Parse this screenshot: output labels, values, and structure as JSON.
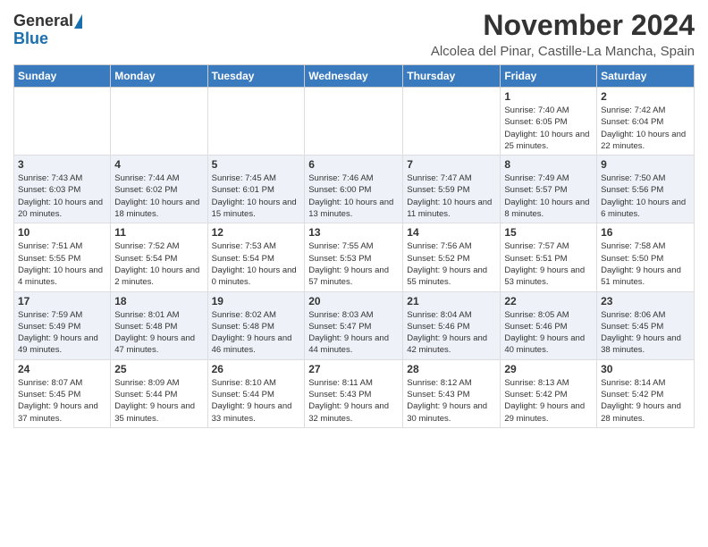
{
  "header": {
    "logo_general": "General",
    "logo_blue": "Blue",
    "month": "November 2024",
    "location": "Alcolea del Pinar, Castille-La Mancha, Spain"
  },
  "columns": [
    "Sunday",
    "Monday",
    "Tuesday",
    "Wednesday",
    "Thursday",
    "Friday",
    "Saturday"
  ],
  "weeks": [
    [
      {
        "day": "",
        "info": ""
      },
      {
        "day": "",
        "info": ""
      },
      {
        "day": "",
        "info": ""
      },
      {
        "day": "",
        "info": ""
      },
      {
        "day": "",
        "info": ""
      },
      {
        "day": "1",
        "info": "Sunrise: 7:40 AM\nSunset: 6:05 PM\nDaylight: 10 hours and 25 minutes."
      },
      {
        "day": "2",
        "info": "Sunrise: 7:42 AM\nSunset: 6:04 PM\nDaylight: 10 hours and 22 minutes."
      }
    ],
    [
      {
        "day": "3",
        "info": "Sunrise: 7:43 AM\nSunset: 6:03 PM\nDaylight: 10 hours and 20 minutes."
      },
      {
        "day": "4",
        "info": "Sunrise: 7:44 AM\nSunset: 6:02 PM\nDaylight: 10 hours and 18 minutes."
      },
      {
        "day": "5",
        "info": "Sunrise: 7:45 AM\nSunset: 6:01 PM\nDaylight: 10 hours and 15 minutes."
      },
      {
        "day": "6",
        "info": "Sunrise: 7:46 AM\nSunset: 6:00 PM\nDaylight: 10 hours and 13 minutes."
      },
      {
        "day": "7",
        "info": "Sunrise: 7:47 AM\nSunset: 5:59 PM\nDaylight: 10 hours and 11 minutes."
      },
      {
        "day": "8",
        "info": "Sunrise: 7:49 AM\nSunset: 5:57 PM\nDaylight: 10 hours and 8 minutes."
      },
      {
        "day": "9",
        "info": "Sunrise: 7:50 AM\nSunset: 5:56 PM\nDaylight: 10 hours and 6 minutes."
      }
    ],
    [
      {
        "day": "10",
        "info": "Sunrise: 7:51 AM\nSunset: 5:55 PM\nDaylight: 10 hours and 4 minutes."
      },
      {
        "day": "11",
        "info": "Sunrise: 7:52 AM\nSunset: 5:54 PM\nDaylight: 10 hours and 2 minutes."
      },
      {
        "day": "12",
        "info": "Sunrise: 7:53 AM\nSunset: 5:54 PM\nDaylight: 10 hours and 0 minutes."
      },
      {
        "day": "13",
        "info": "Sunrise: 7:55 AM\nSunset: 5:53 PM\nDaylight: 9 hours and 57 minutes."
      },
      {
        "day": "14",
        "info": "Sunrise: 7:56 AM\nSunset: 5:52 PM\nDaylight: 9 hours and 55 minutes."
      },
      {
        "day": "15",
        "info": "Sunrise: 7:57 AM\nSunset: 5:51 PM\nDaylight: 9 hours and 53 minutes."
      },
      {
        "day": "16",
        "info": "Sunrise: 7:58 AM\nSunset: 5:50 PM\nDaylight: 9 hours and 51 minutes."
      }
    ],
    [
      {
        "day": "17",
        "info": "Sunrise: 7:59 AM\nSunset: 5:49 PM\nDaylight: 9 hours and 49 minutes."
      },
      {
        "day": "18",
        "info": "Sunrise: 8:01 AM\nSunset: 5:48 PM\nDaylight: 9 hours and 47 minutes."
      },
      {
        "day": "19",
        "info": "Sunrise: 8:02 AM\nSunset: 5:48 PM\nDaylight: 9 hours and 46 minutes."
      },
      {
        "day": "20",
        "info": "Sunrise: 8:03 AM\nSunset: 5:47 PM\nDaylight: 9 hours and 44 minutes."
      },
      {
        "day": "21",
        "info": "Sunrise: 8:04 AM\nSunset: 5:46 PM\nDaylight: 9 hours and 42 minutes."
      },
      {
        "day": "22",
        "info": "Sunrise: 8:05 AM\nSunset: 5:46 PM\nDaylight: 9 hours and 40 minutes."
      },
      {
        "day": "23",
        "info": "Sunrise: 8:06 AM\nSunset: 5:45 PM\nDaylight: 9 hours and 38 minutes."
      }
    ],
    [
      {
        "day": "24",
        "info": "Sunrise: 8:07 AM\nSunset: 5:45 PM\nDaylight: 9 hours and 37 minutes."
      },
      {
        "day": "25",
        "info": "Sunrise: 8:09 AM\nSunset: 5:44 PM\nDaylight: 9 hours and 35 minutes."
      },
      {
        "day": "26",
        "info": "Sunrise: 8:10 AM\nSunset: 5:44 PM\nDaylight: 9 hours and 33 minutes."
      },
      {
        "day": "27",
        "info": "Sunrise: 8:11 AM\nSunset: 5:43 PM\nDaylight: 9 hours and 32 minutes."
      },
      {
        "day": "28",
        "info": "Sunrise: 8:12 AM\nSunset: 5:43 PM\nDaylight: 9 hours and 30 minutes."
      },
      {
        "day": "29",
        "info": "Sunrise: 8:13 AM\nSunset: 5:42 PM\nDaylight: 9 hours and 29 minutes."
      },
      {
        "day": "30",
        "info": "Sunrise: 8:14 AM\nSunset: 5:42 PM\nDaylight: 9 hours and 28 minutes."
      }
    ]
  ]
}
